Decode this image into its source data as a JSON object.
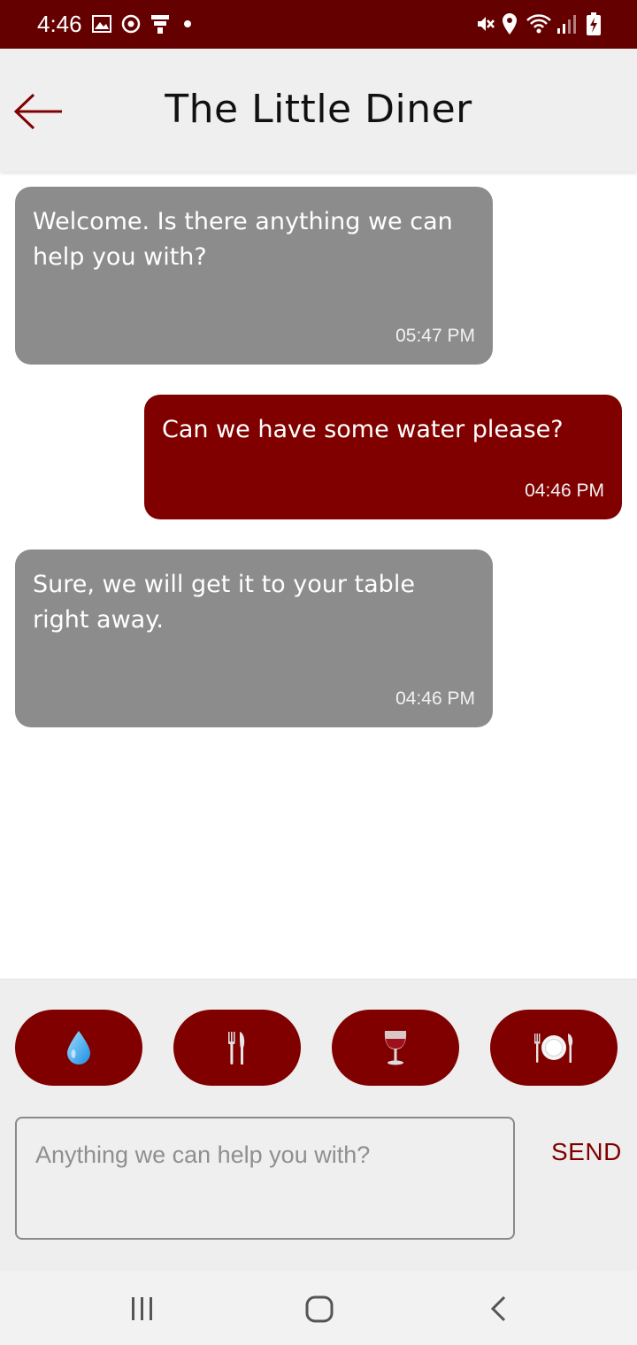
{
  "status_bar": {
    "time": "4:46",
    "left_icons": [
      "image-icon",
      "sync-icon",
      "stack-icon",
      "dot-icon"
    ],
    "right_icons": [
      "mute-icon",
      "location-icon",
      "wifi-icon",
      "signal-icon",
      "battery-charging-icon"
    ]
  },
  "header": {
    "title": "The Little Diner",
    "back_icon": "arrow-left-icon"
  },
  "messages": [
    {
      "direction": "incoming",
      "text": "Welcome. Is there anything we can help you with?",
      "time": "05:47 PM"
    },
    {
      "direction": "outgoing",
      "text": "Can we have some water please?",
      "time": "04:46 PM"
    },
    {
      "direction": "incoming",
      "text": "Sure, we will get it to your table right away.",
      "time": "04:46 PM"
    }
  ],
  "quick_actions": [
    {
      "icon": "water-droplet-icon"
    },
    {
      "icon": "cutlery-icon"
    },
    {
      "icon": "wine-glass-icon"
    },
    {
      "icon": "plate-icon"
    }
  ],
  "composer": {
    "placeholder": "Anything we can help you with?",
    "value": "",
    "send_label": "SEND"
  },
  "nav_bar": {
    "icons": [
      "recent-apps-icon",
      "home-icon",
      "back-icon"
    ]
  },
  "colors": {
    "brand": "#800000",
    "status_bar": "#650000",
    "incoming_bubble": "#8c8c8c",
    "app_bar": "#efefef"
  }
}
